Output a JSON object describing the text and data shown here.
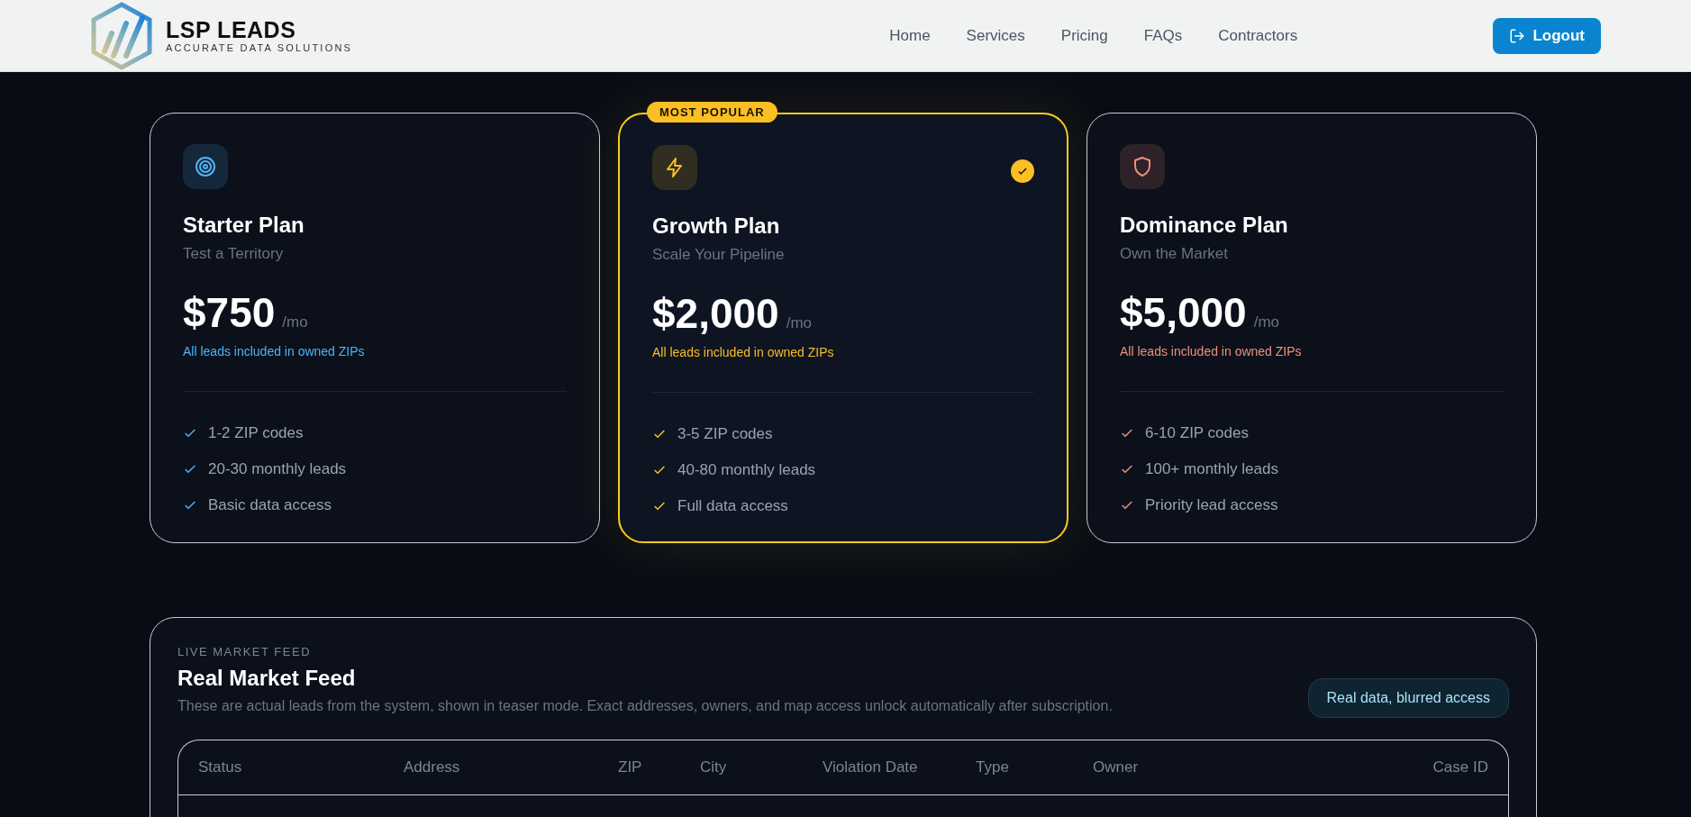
{
  "header": {
    "brand": "LSP LEADS",
    "tagline": "ACCURATE DATA SOLUTIONS",
    "nav": [
      {
        "label": "Home"
      },
      {
        "label": "Services"
      },
      {
        "label": "Pricing"
      },
      {
        "label": "FAQs"
      },
      {
        "label": "Contractors"
      }
    ],
    "logout": "Logout"
  },
  "plans": [
    {
      "title": "Starter Plan",
      "subtitle": "Test a Territory",
      "price": "$750",
      "period": "/mo",
      "note": "All leads included in owned ZIPs",
      "color": "#4fb3f5",
      "selected": false,
      "features": [
        "1-2 ZIP codes",
        "20-30 monthly leads",
        "Basic data access"
      ]
    },
    {
      "badge": "MOST POPULAR",
      "title": "Growth Plan",
      "subtitle": "Scale Your Pipeline",
      "price": "$2,000",
      "period": "/mo",
      "note": "All leads included in owned ZIPs",
      "color": "#fbbf24",
      "selected": true,
      "features": [
        "3-5 ZIP codes",
        "40-80 monthly leads",
        "Full data access"
      ]
    },
    {
      "title": "Dominance Plan",
      "subtitle": "Own the Market",
      "price": "$5,000",
      "period": "/mo",
      "note": "All leads included in owned ZIPs",
      "color": "#f0907a",
      "selected": false,
      "features": [
        "6-10 ZIP codes",
        "100+ monthly leads",
        "Priority lead access"
      ]
    }
  ],
  "feed": {
    "eyebrow": "LIVE MARKET FEED",
    "title": "Real Market Feed",
    "description": "These are actual leads from the system, shown in teaser mode. Exact addresses, owners, and map access unlock automatically after subscription.",
    "badge": "Real data, blurred access",
    "table": {
      "columns": [
        "Status",
        "Address",
        "ZIP",
        "City",
        "Violation Date",
        "Type",
        "Owner",
        "Case ID"
      ]
    }
  }
}
